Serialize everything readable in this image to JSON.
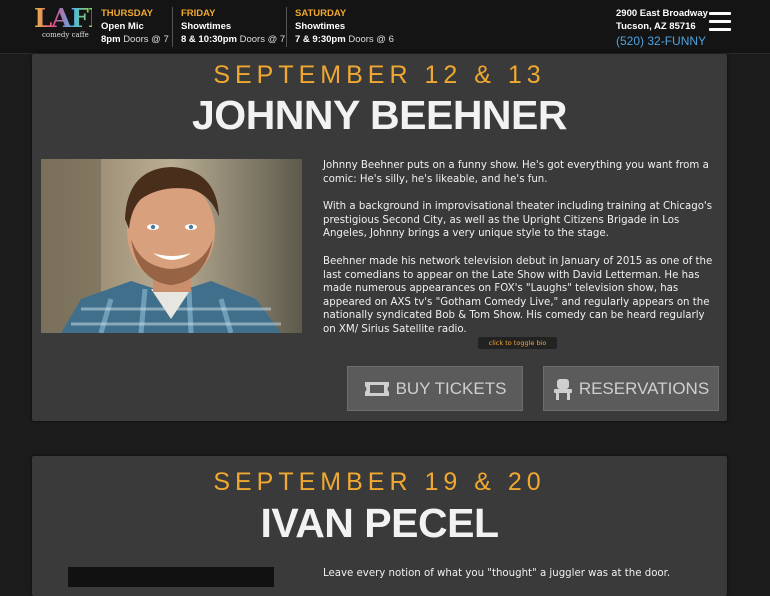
{
  "header": {
    "logo": {
      "mark": "LAFFS",
      "sub": "comedy caffe"
    },
    "days": [
      {
        "name": "THURSDAY",
        "line2": "Open Mic",
        "time": "8pm",
        "doors": "Doors @ 7"
      },
      {
        "name": "FRIDAY",
        "line2": "Showtimes",
        "time": "8 & 10:30pm",
        "doors": "Doors @ 7"
      },
      {
        "name": "SATURDAY",
        "line2": "Showtimes",
        "time": "7 & 9:30pm",
        "doors": "Doors @ 6"
      }
    ],
    "address_line1": "2900 East Broadway",
    "address_line2": "Tucson, AZ 85716",
    "phone": "(520) 32-FUNNY",
    "menu_icon": "hamburger-menu-icon"
  },
  "shows": [
    {
      "date": "SEPTEMBER 12 & 13",
      "name": "JOHNNY BEEHNER",
      "bio": [
        "Johnny Beehner puts on a funny show. He's got everything you want from a comic: He's silly, he's likeable, and he's fun.",
        "With a background in improvisational theater including training at Chicago's prestigious Second City, as well as the Upright Citizens Brigade in Los Angeles, Johnny brings a very unique style to the stage.",
        "Beehner made his network television debut in January of 2015 as one of the last comedians to appear on the Late Show with David Letterman. He has made numerous appearances on FOX's \"Laughs\" television show, has appeared on AXS tv's \"Gotham Comedy Live,\" and regularly appears on the nationally syndicated Bob & Tom Show. His comedy can be heard regularly on XM/ Sirius Satellite radio."
      ],
      "toggle_label": "click to toggle bio",
      "buy_label": "BUY TICKETS",
      "reserve_label": "RESERVATIONS"
    },
    {
      "date": "SEPTEMBER 19 & 20",
      "name": "IVAN PECEL",
      "bio_start": "Leave every notion of what you \"thought\" a juggler was at the door."
    }
  ],
  "colors": {
    "accent": "#f0a830",
    "phone": "#4fa3e0",
    "card": "#3a3a3a"
  }
}
